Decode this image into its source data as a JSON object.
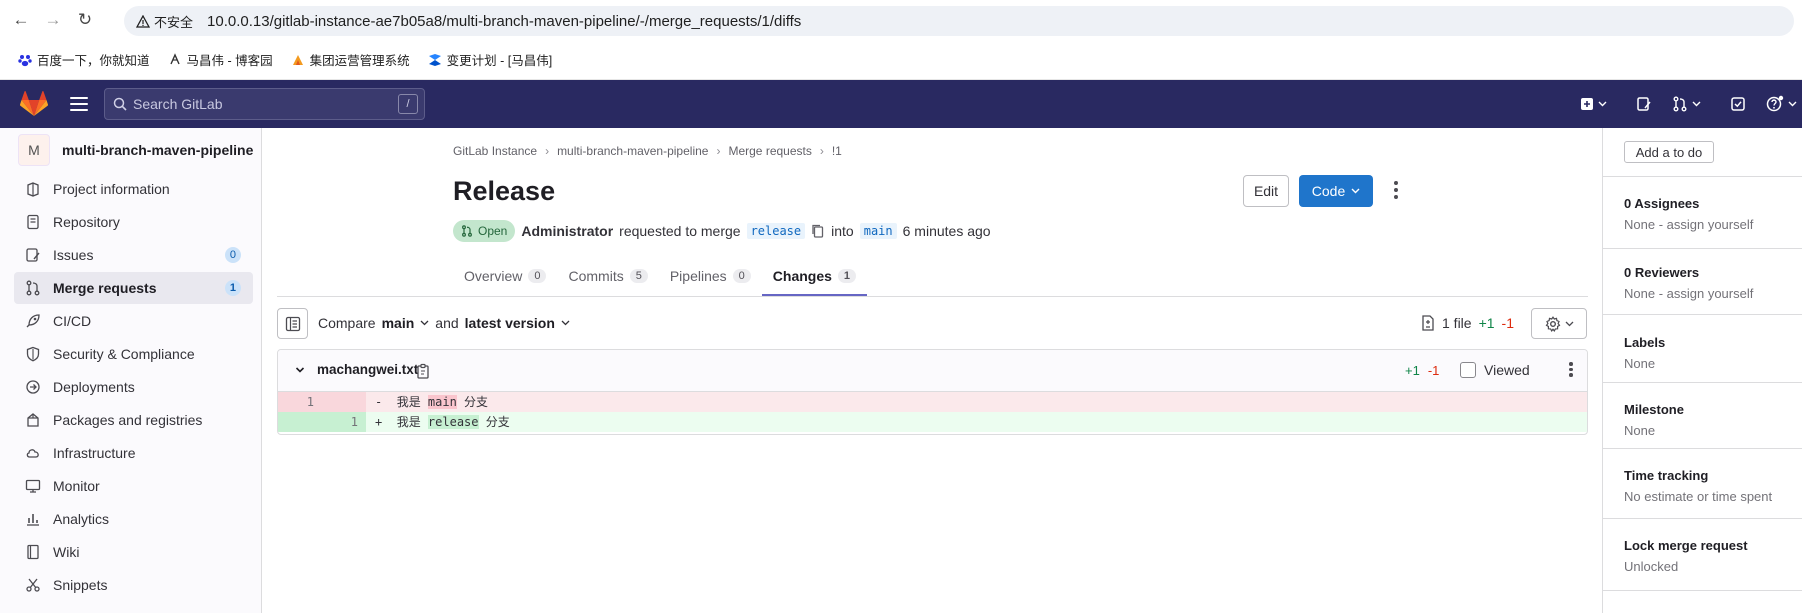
{
  "browser": {
    "insecure_label": "不安全",
    "url": "10.0.0.13/gitlab-instance-ae7b05a8/multi-branch-maven-pipeline/-/merge_requests/1/diffs",
    "bookmarks": [
      {
        "label": "百度一下，你就知道",
        "icon": "baidu-icon"
      },
      {
        "label": "马昌伟 - 博客园",
        "icon": "cnblogs-icon"
      },
      {
        "label": "集团运营管理系统",
        "icon": "ops-icon"
      },
      {
        "label": "变更计划 - [马昌伟]",
        "icon": "jira-icon"
      }
    ]
  },
  "topbar": {
    "search_placeholder": "Search GitLab",
    "search_shortcut": "/"
  },
  "project": {
    "avatar_letter": "M",
    "name": "multi-branch-maven-pipeline"
  },
  "nav": [
    {
      "label": "Project information",
      "icon": "project-info-icon"
    },
    {
      "label": "Repository",
      "icon": "repository-icon"
    },
    {
      "label": "Issues",
      "icon": "issues-icon",
      "badge": "0"
    },
    {
      "label": "Merge requests",
      "icon": "merge-request-icon",
      "badge": "1",
      "active": true
    },
    {
      "label": "CI/CD",
      "icon": "rocket-icon"
    },
    {
      "label": "Security & Compliance",
      "icon": "shield-icon"
    },
    {
      "label": "Deployments",
      "icon": "deployments-icon"
    },
    {
      "label": "Packages and registries",
      "icon": "package-icon"
    },
    {
      "label": "Infrastructure",
      "icon": "cloud-icon"
    },
    {
      "label": "Monitor",
      "icon": "monitor-icon"
    },
    {
      "label": "Analytics",
      "icon": "analytics-icon"
    },
    {
      "label": "Wiki",
      "icon": "book-icon"
    },
    {
      "label": "Snippets",
      "icon": "snippet-icon"
    }
  ],
  "breadcrumb": [
    "GitLab Instance",
    "multi-branch-maven-pipeline",
    "Merge requests",
    "!1"
  ],
  "mr": {
    "title": "Release",
    "edit_label": "Edit",
    "code_label": "Code",
    "status": "Open",
    "author": "Administrator",
    "requested_text": "requested to merge",
    "source_branch": "release",
    "into_text": "into",
    "target_branch": "main",
    "time": "6 minutes ago"
  },
  "tabs": [
    {
      "label": "Overview",
      "count": "0"
    },
    {
      "label": "Commits",
      "count": "5"
    },
    {
      "label": "Pipelines",
      "count": "0"
    },
    {
      "label": "Changes",
      "count": "1",
      "active": true
    }
  ],
  "compare": {
    "compare_label": "Compare",
    "base": "main",
    "and_label": "and",
    "version": "latest version",
    "files": "1 file",
    "additions": "+1",
    "deletions": "-1"
  },
  "diff": {
    "filename": "machangwei.txt",
    "additions": "+1",
    "deletions": "-1",
    "viewed_label": "Viewed",
    "lines": [
      {
        "type": "old",
        "old_ln": "1",
        "new_ln": "",
        "sign": "-",
        "pre": "我是 ",
        "hl": "main",
        "post": " 分支"
      },
      {
        "type": "new",
        "old_ln": "",
        "new_ln": "1",
        "sign": "+",
        "pre": "我是 ",
        "hl": "release",
        "post": " 分支"
      }
    ]
  },
  "right": {
    "todo_label": "Add a to do",
    "assignees_title": "0 Assignees",
    "assignees_value": "None - assign yourself",
    "reviewers_title": "0 Reviewers",
    "reviewers_value": "None - assign yourself",
    "labels_title": "Labels",
    "labels_value": "None",
    "milestone_title": "Milestone",
    "milestone_value": "None",
    "time_title": "Time tracking",
    "time_value": "No estimate or time spent",
    "lock_title": "Lock merge request",
    "lock_value": "Unlocked"
  },
  "colors": {
    "topbar": "#292961",
    "primary": "#1f75cb",
    "added": "#108548",
    "removed": "#dd2b0e"
  }
}
